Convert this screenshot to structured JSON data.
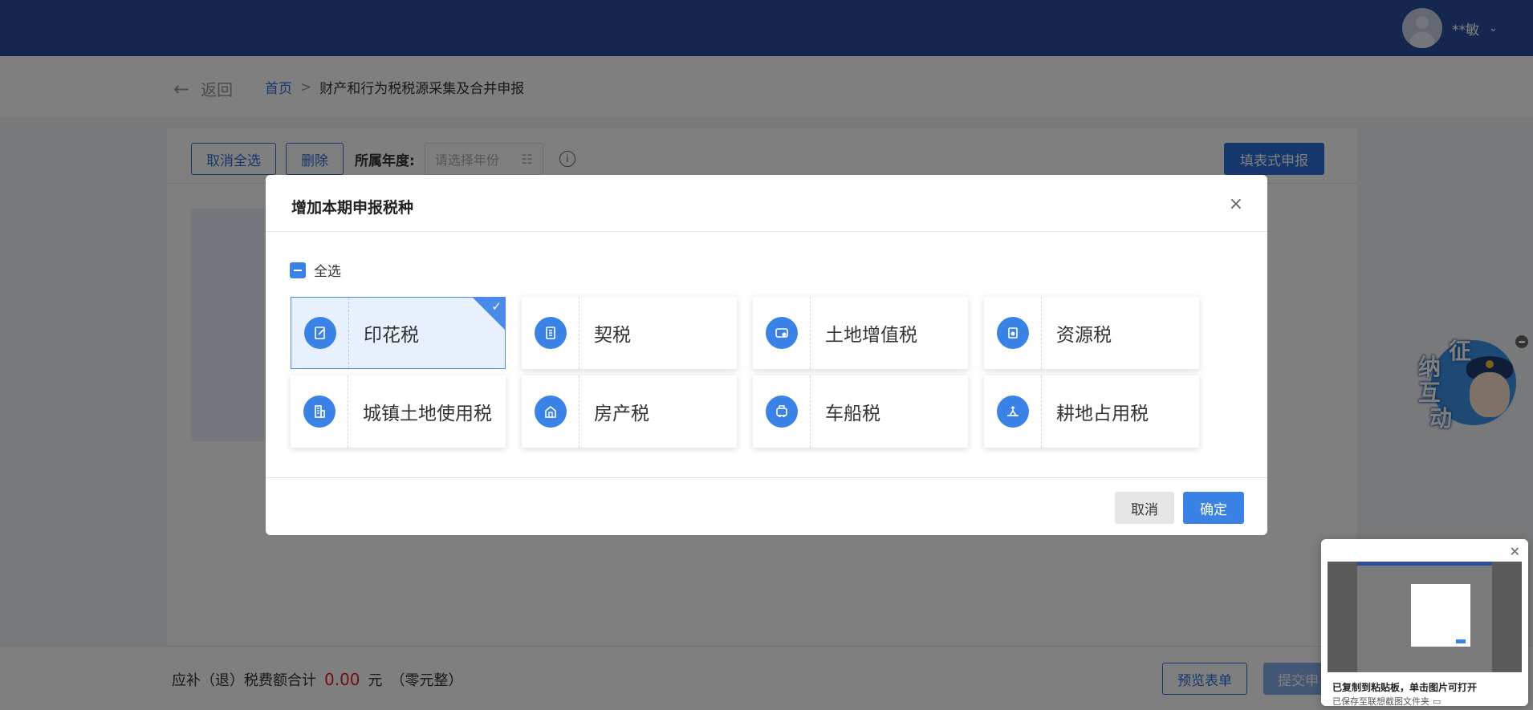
{
  "header": {
    "user_name": "**敏"
  },
  "breadcrumb": {
    "back_label": "返回",
    "home": "首页",
    "sep": ">",
    "current": "财产和行为税税源采集及合并申报"
  },
  "toolbar": {
    "cancel_select_all": "取消全选",
    "delete": "删除",
    "year_label": "所属年度:",
    "year_placeholder": "请选择年份",
    "fill_report": "填表式申报"
  },
  "footer": {
    "total_label": "应补（退）税费额合计",
    "amount": "0.00",
    "unit": "元",
    "amount_words": "（零元整）",
    "preview": "预览表单",
    "submit": "提交申"
  },
  "mascot": {
    "chars": [
      "征",
      "纳",
      "互",
      "动"
    ]
  },
  "modal": {
    "title": "增加本期申报税种",
    "close": "×",
    "select_all": "全选",
    "taxes": [
      {
        "name": "印花税",
        "icon": "stamp-icon",
        "selected": true
      },
      {
        "name": "契税",
        "icon": "document-icon",
        "selected": false
      },
      {
        "name": "土地增值税",
        "icon": "land-value-icon",
        "selected": false
      },
      {
        "name": "资源税",
        "icon": "resource-icon",
        "selected": false
      },
      {
        "name": "城镇土地使用税",
        "icon": "building-icon",
        "selected": false
      },
      {
        "name": "房产税",
        "icon": "house-icon",
        "selected": false
      },
      {
        "name": "车船税",
        "icon": "vehicle-icon",
        "selected": false
      },
      {
        "name": "耕地占用税",
        "icon": "farmland-icon",
        "selected": false
      }
    ],
    "cancel": "取消",
    "confirm": "确定"
  },
  "toast": {
    "title": "已复制到粘贴板，单击图片可打开",
    "subtitle": "已保存至联想截图文件夹"
  },
  "colors": {
    "primary": "#3b82e6",
    "header": "#2a4f9e",
    "danger": "#e02020"
  }
}
